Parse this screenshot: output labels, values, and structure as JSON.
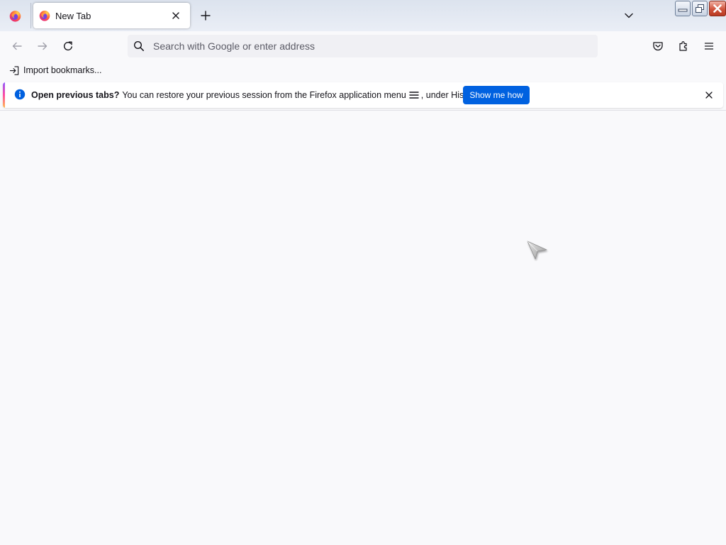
{
  "tabstrip": {
    "tabs": [
      {
        "title": "New Tab",
        "icon": "firefox-logo-icon"
      }
    ],
    "new_tab_icon": "plus-icon",
    "list_tabs_icon": "chevron-down-icon"
  },
  "window_controls": {
    "icons": [
      "minimize-icon",
      "restore-icon",
      "close-icon"
    ]
  },
  "navbar": {
    "urlbar": {
      "placeholder": "Search with Google or enter address",
      "value": ""
    },
    "icons": [
      "back-icon",
      "forward-icon",
      "reload-icon",
      "pocket-icon",
      "extensions-icon",
      "menu-icon"
    ]
  },
  "bookmarks": {
    "import_label": "Import bookmarks..."
  },
  "notification": {
    "title": "Open previous tabs?",
    "message_before": "You can restore your previous session from the Firefox application menu",
    "message_after": ", under History.",
    "button_label": "Show me how"
  },
  "colors": {
    "accent_button": "#0061e0",
    "info_icon": "#0060df",
    "page_background": "#f9f9fb"
  }
}
